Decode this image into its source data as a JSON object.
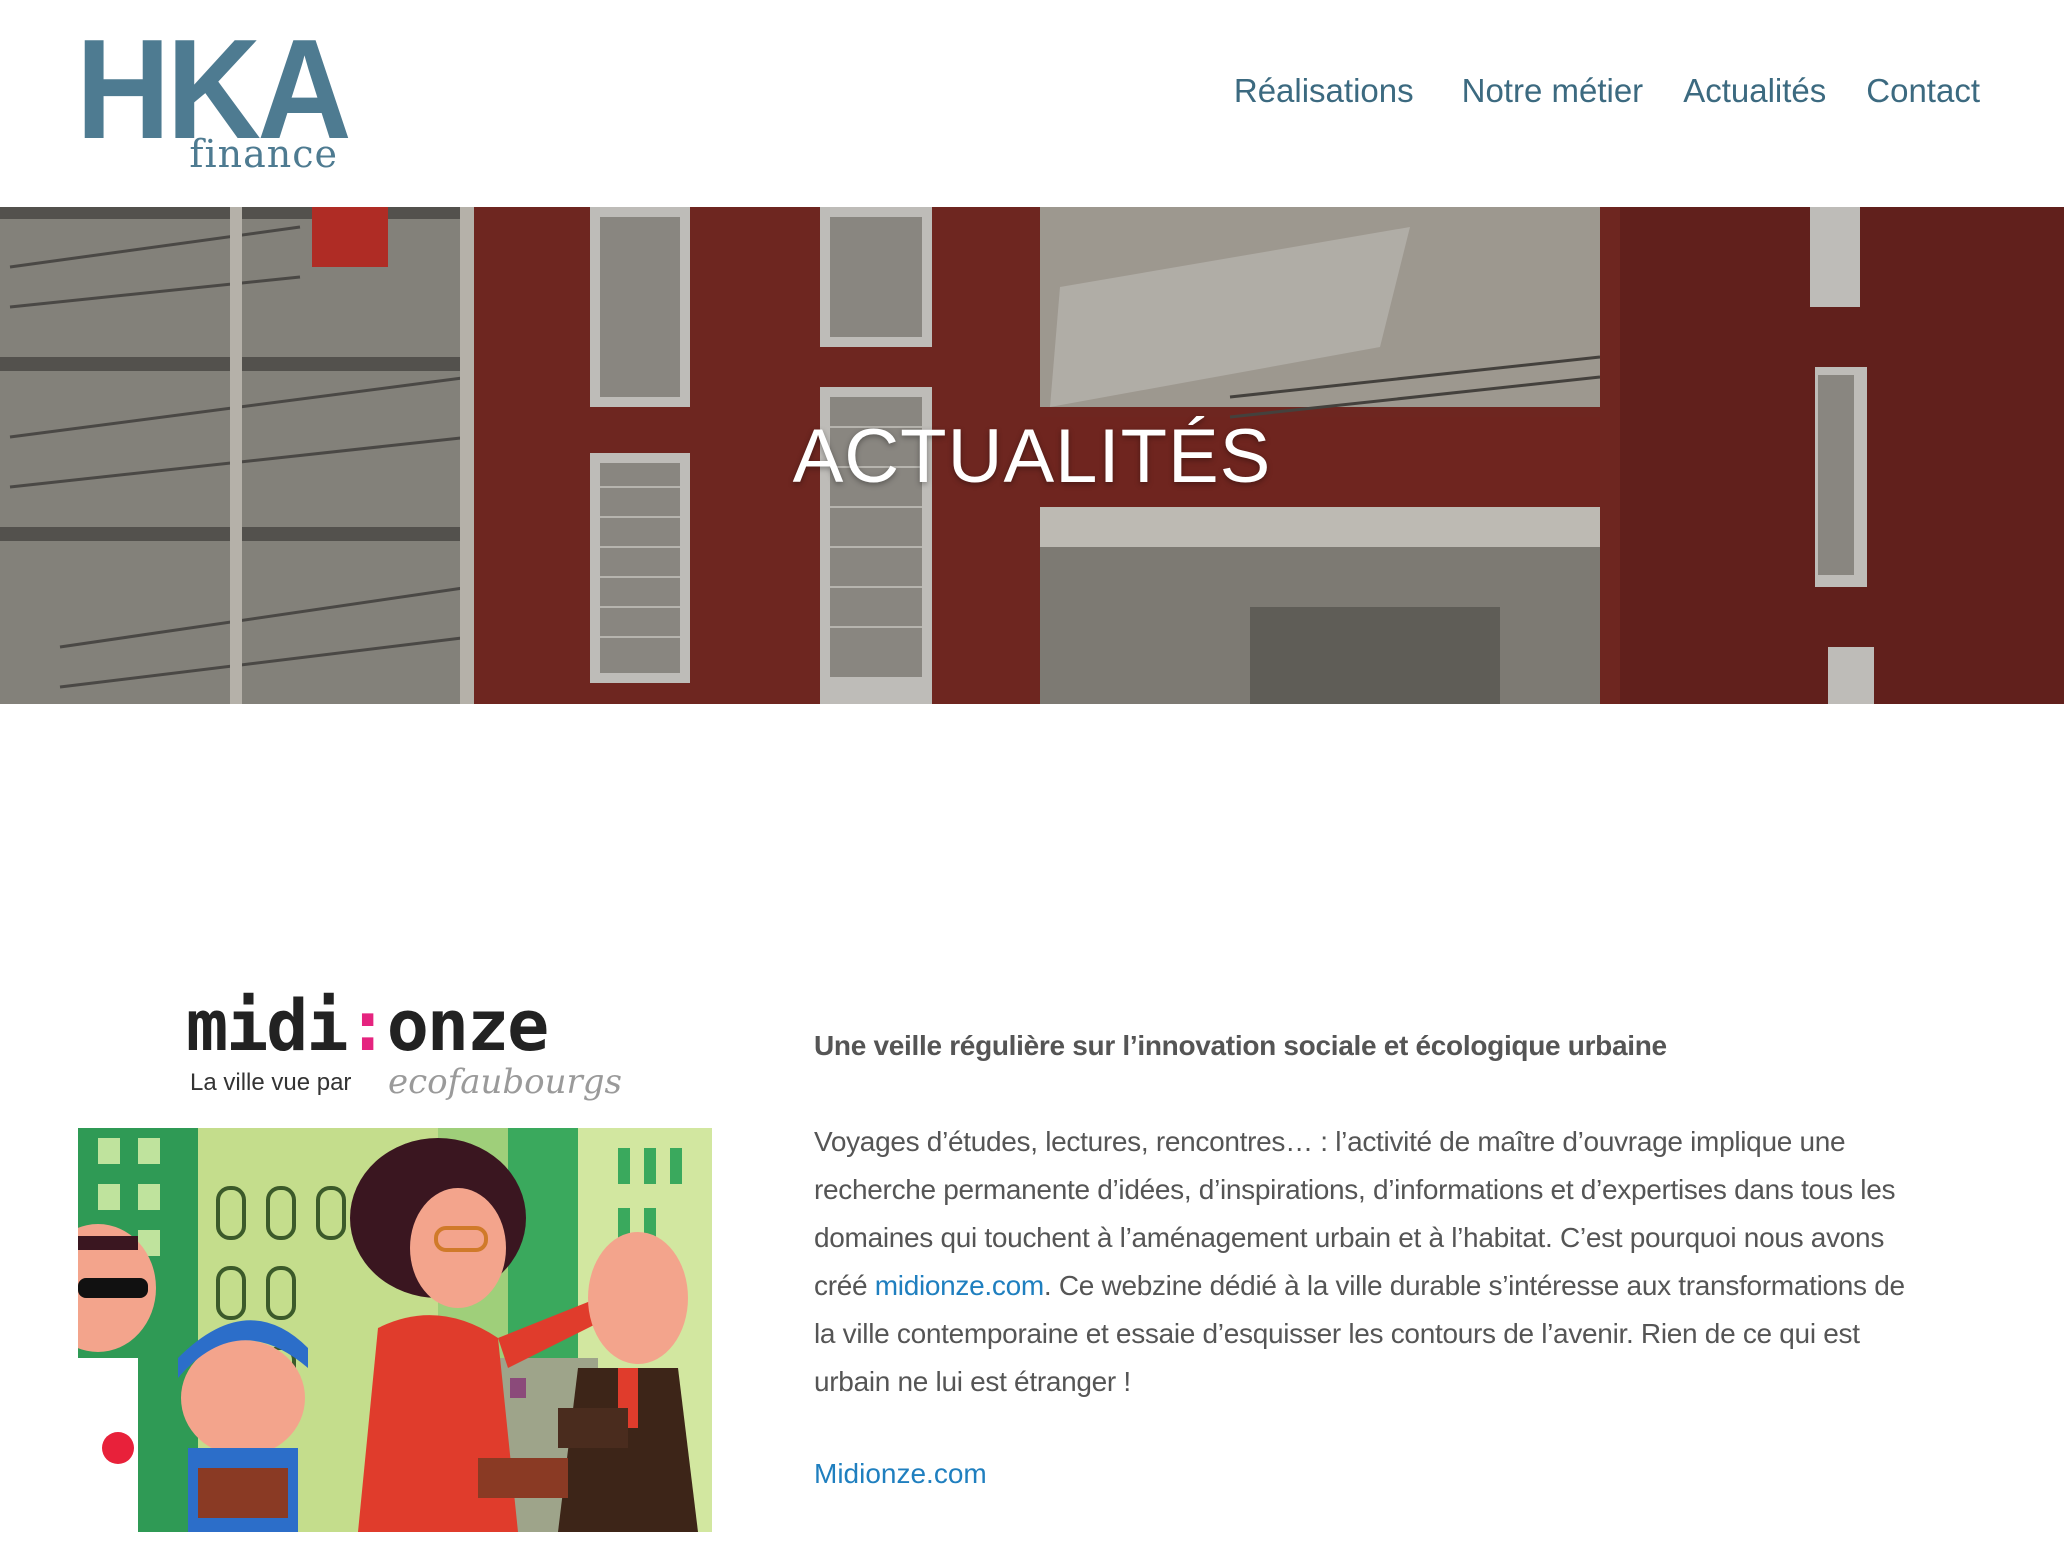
{
  "header": {
    "logo_main": "HKA",
    "logo_sub": "finance",
    "nav": [
      {
        "label": "Réalisations"
      },
      {
        "label": "Notre métier"
      },
      {
        "label": "Actualités"
      },
      {
        "label": "Contact"
      }
    ]
  },
  "hero": {
    "title": "ACTUALITÉS"
  },
  "article": {
    "logo": {
      "word_left": "midi",
      "word_sep": ":",
      "word_right": "onze",
      "tagline": "La ville vue par",
      "brand": "ecofaubourgs"
    },
    "heading": "Une veille régulière sur l’innovation sociale et écologique urbaine",
    "body_before": "Voyages d’études, lectures, rencontres… : l’activité de maître d’ouvrage implique une recherche permanente d’idées, d’inspirations, d’informations et d’expertises dans tous les domaines qui touchent à l’aménagement urbain et à l’habitat. C’est pourquoi nous avons créé ",
    "body_link": "midionze.com",
    "body_after": ". Ce webzine dédié à la ville durable s’intéresse aux transformations de la ville contemporaine et essaie d’esquisser les contours de l’avenir. Rien de ce qui est urbain ne lui est étranger !",
    "more_link": "Midionze.com"
  },
  "colors": {
    "brand": "#4e7b91",
    "nav": "#3c6a80",
    "link": "#1f7fbf",
    "accent_pink": "#e5247f",
    "facade_red": "#7a2a24"
  }
}
